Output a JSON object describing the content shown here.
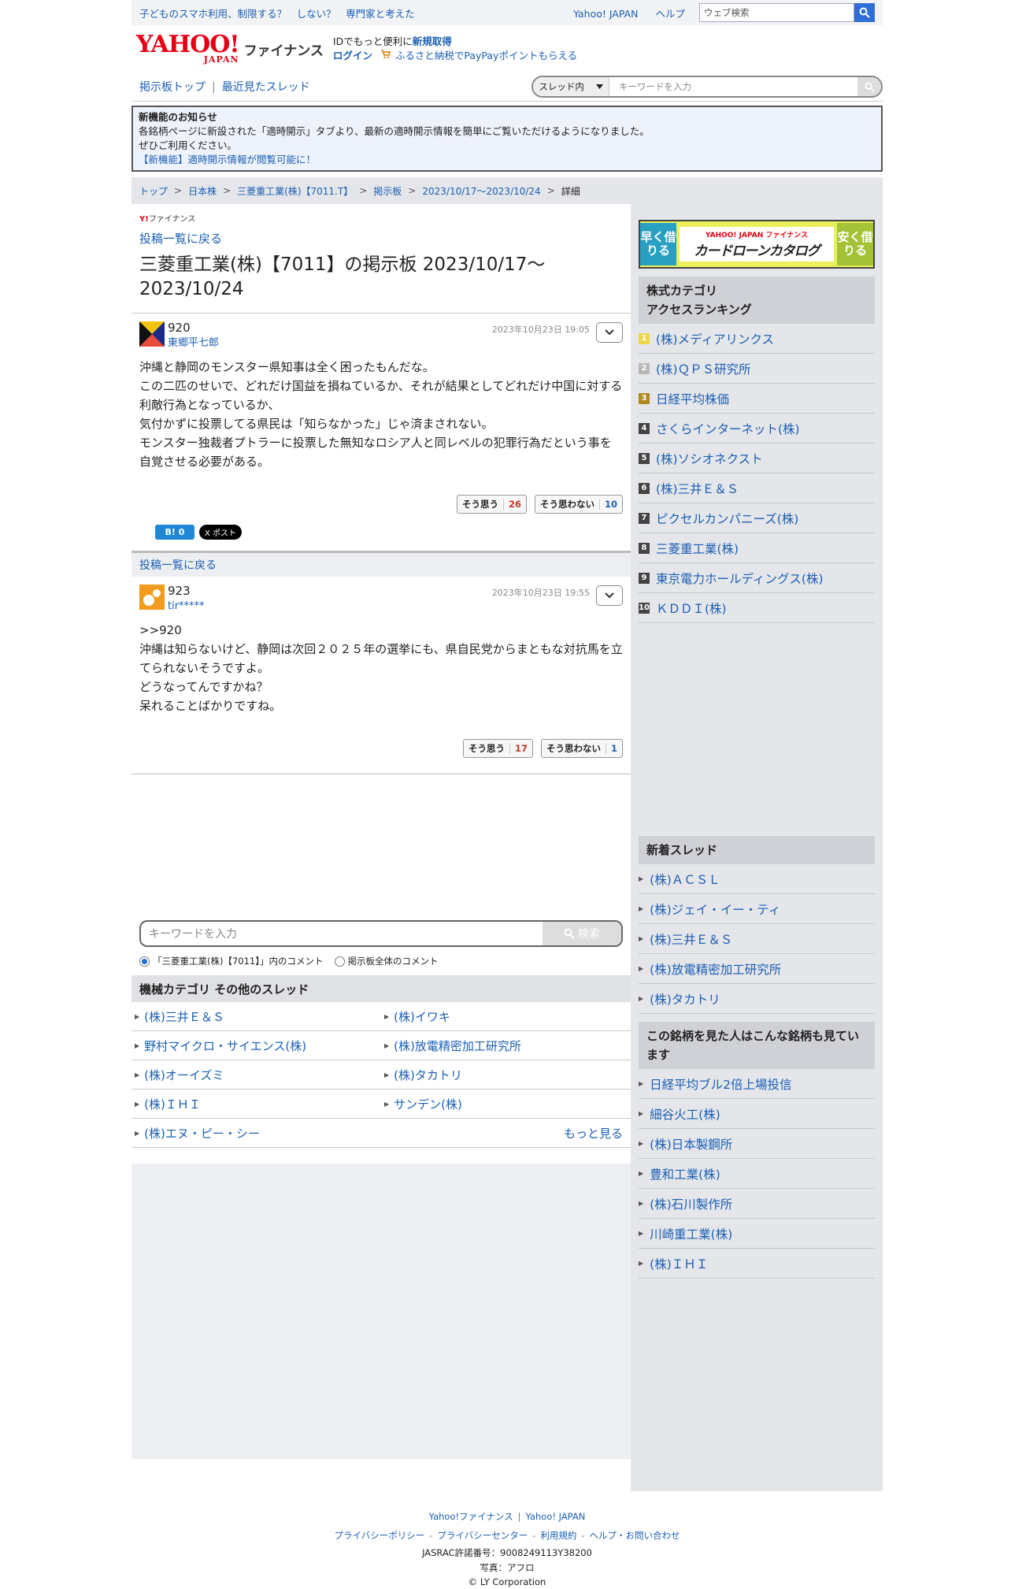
{
  "topbar": {
    "promo": "子どものスマホ利用、制限する？　しない？　専門家と考えた",
    "links": [
      "Yahoo! JAPAN",
      "ヘルプ"
    ],
    "search_placeholder": "ウェブ検索"
  },
  "header": {
    "logo_main": "YAHOO!",
    "logo_sub": "JAPAN",
    "logo_finance": "ファイナンス",
    "id_text": "IDでもっと便利に",
    "signup": "新規取得",
    "login": "ログイン",
    "furusato": "ふるさと納税でPayPayポイントもらえる"
  },
  "nav": {
    "links": [
      "掲示板トップ",
      "最近見たスレッド"
    ],
    "scope": "スレッド内",
    "search_placeholder": "キーワードを入力"
  },
  "notice": {
    "title": "新機能のお知らせ",
    "line1": "各銘柄ページに新設された「適時開示」タブより、最新の適時開示情報を簡単にご覧いただけるようになりました。",
    "line2": "ぜひご利用ください。",
    "link": "【新機能】適時開示情報が閲覧可能に！"
  },
  "breadcrumb": [
    "トップ",
    "日本株",
    "三菱重工業(株)【7011.T】",
    "掲示板",
    "2023/10/17〜2023/10/24",
    "詳細"
  ],
  "main": {
    "brand": "ファイナンス",
    "back_link": "投稿一覧に戻る",
    "title": "三菱重工業(株)【7011】の掲示板 2023/10/17〜2023/10/24",
    "posts": [
      {
        "num": "920",
        "user": "東郷平七郎",
        "date": "2023年10月23日 19:05",
        "body": "沖縄と静岡のモンスター県知事は全く困ったもんだな。\nこの二匹のせいで、どれだけ国益を損ねているか、それが結果としてどれだけ中国に対する利敵行為となっているか、\n気付かずに投票してる県民は「知らなかった」じゃ済まされない。\nモンスター独裁者プトラーに投票した無知なロシア人と同レベルの犯罪行為だという事を自覚させる必要がある。",
        "agree_label": "そう思う",
        "agree": "26",
        "disagree_label": "そう思わない",
        "disagree": "10"
      },
      {
        "num": "923",
        "user": "tir*****",
        "date": "2023年10月23日 19:55",
        "body": ">>920\n沖縄は知らないけど、静岡は次回２０２５年の選挙にも、県自民党からまともな対抗馬を立てられないそうですよ。\nどうなってんですかね？\n呆れることばかりですね。",
        "agree_label": "そう思う",
        "agree": "17",
        "disagree_label": "そう思わない",
        "disagree": "1"
      }
    ],
    "share": {
      "hatena": "B! 0",
      "x": "X ポスト"
    },
    "back_link2": "投稿一覧に戻る",
    "keyword_placeholder": "キーワードを入力",
    "search_btn": "検索",
    "radio1": "「三菱重工業(株)【7011】」内のコメント",
    "radio2": "掲示板全体のコメント",
    "other_head": "機械カテゴリ  その他のスレッド",
    "other": [
      "(株)三井Ｅ＆Ｓ",
      "(株)イワキ",
      "野村マイクロ・サイエンス(株)",
      "(株)放電精密加工研究所",
      "(株)オーイズミ",
      "(株)タカトリ",
      "(株)ＩＨＩ",
      "サンデン(株)",
      "(株)エヌ・ピー・シー"
    ],
    "more": "もっと見る"
  },
  "side": {
    "ad": {
      "left": "早く借りる",
      "brand": "YAHOO! JAPAN ファイナンス",
      "title": "カードローンカタログ",
      "right": "安く借りる"
    },
    "ranking_head1": "株式カテゴリ",
    "ranking_head2": "アクセスランキング",
    "ranking": [
      "(株)メディアリンクス",
      "(株)ＱＰＳ研究所",
      "日経平均株価",
      "さくらインターネット(株)",
      "(株)ソシオネクスト",
      "(株)三井Ｅ＆Ｓ",
      "ピクセルカンパニーズ(株)",
      "三菱重工業(株)",
      "東京電力ホールディングス(株)",
      "ＫＤＤＩ(株)"
    ],
    "new_head": "新着スレッド",
    "new_threads": [
      "(株)ＡＣＳＬ",
      "(株)ジェイ・イー・ティ",
      "(株)三井Ｅ＆Ｓ",
      "(株)放電精密加工研究所",
      "(株)タカトリ"
    ],
    "seen_head": "この銘柄を見た人はこんな銘柄も見ています",
    "seen": [
      "日経平均ブル2倍上場投信",
      "細谷火工(株)",
      "(株)日本製鋼所",
      "豊和工業(株)",
      "(株)石川製作所",
      "川崎重工業(株)",
      "(株)ＩＨＩ"
    ]
  },
  "footer": {
    "row1": [
      "Yahoo!ファイナンス",
      "Yahoo! JAPAN"
    ],
    "row2": [
      "プライバシーポリシー",
      "プライバシーセンター",
      "利用規約",
      "ヘルプ・お問い合わせ"
    ],
    "jasrac": "JASRAC許諾番号：9008249113Y38200",
    "photo": "写真：アフロ",
    "copyright": "© LY Corporation"
  }
}
